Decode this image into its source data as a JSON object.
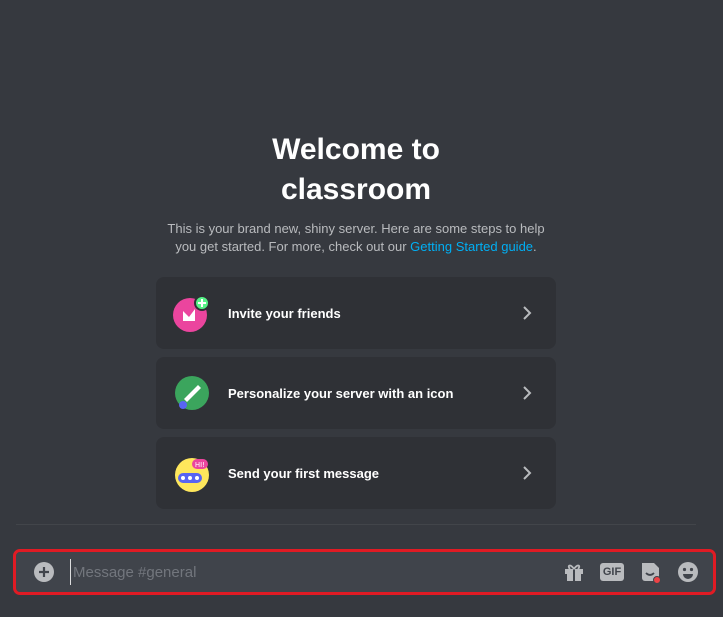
{
  "welcome": {
    "title": "Welcome to classroom",
    "subtitle_text": "This is your brand new, shiny server. Here are some steps to help you get started. For more, check out our ",
    "subtitle_link": "Getting Started guide",
    "subtitle_end": "."
  },
  "cards": [
    {
      "label": "Invite your friends",
      "icon": "invite-friends-icon"
    },
    {
      "label": "Personalize your server with an icon",
      "icon": "paintbrush-icon"
    },
    {
      "label": "Send your first message",
      "icon": "chat-bubble-icon"
    }
  ],
  "composer": {
    "placeholder": "Message #general",
    "gif_label": "GIF"
  },
  "colors": {
    "background": "#36393f",
    "card": "#2f3136",
    "composer": "#40444b",
    "link": "#00aff4",
    "highlight": "#e01b24"
  }
}
